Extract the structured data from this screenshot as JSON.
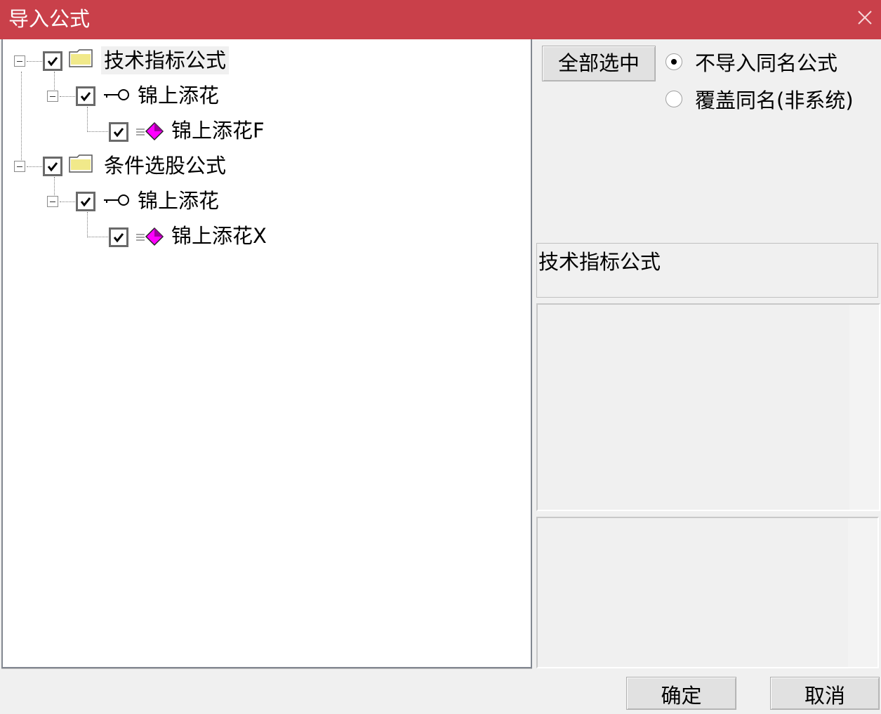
{
  "window": {
    "title": "导入公式",
    "accent_color": "#c9404a"
  },
  "tree": {
    "groups": [
      {
        "label": "技术指标公式",
        "checked": true,
        "icon": "folder-icon",
        "children": [
          {
            "label": "锦上添花",
            "checked": true,
            "icon": "key-icon",
            "children": [
              {
                "label": "锦上添花F",
                "checked": true,
                "icon": "formula-gem-icon"
              }
            ]
          }
        ]
      },
      {
        "label": "条件选股公式",
        "checked": true,
        "icon": "folder-icon",
        "children": [
          {
            "label": "锦上添花",
            "checked": true,
            "icon": "key-icon",
            "children": [
              {
                "label": "锦上添花X",
                "checked": true,
                "icon": "formula-gem-icon"
              }
            ]
          }
        ]
      }
    ]
  },
  "options": {
    "select_all_label": "全部选中",
    "radios": [
      {
        "label": "不导入同名公式",
        "selected": true
      },
      {
        "label": "覆盖同名(非系统)",
        "selected": false
      }
    ]
  },
  "info": {
    "category": "技术指标公式"
  },
  "footer": {
    "ok_label": "确定",
    "cancel_label": "取消"
  }
}
